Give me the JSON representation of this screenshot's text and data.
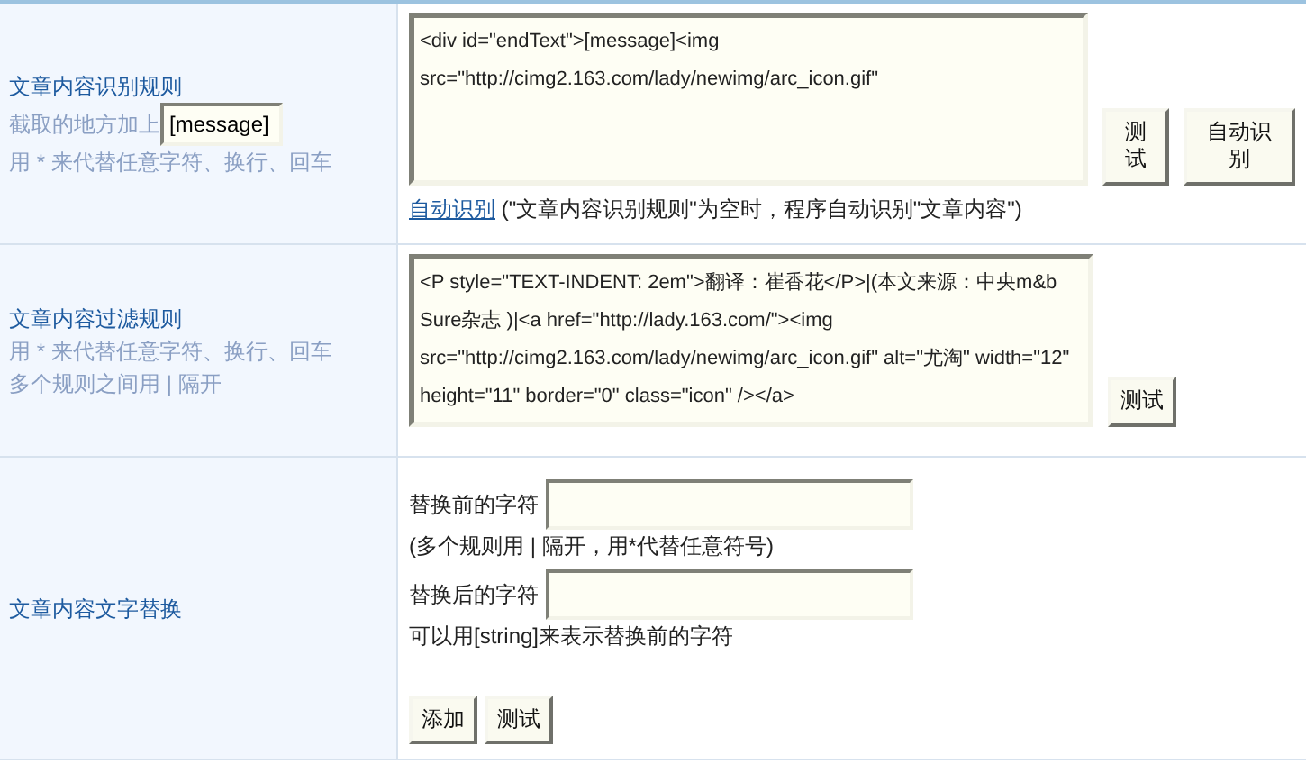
{
  "rows": [
    {
      "kind": "rule",
      "label": "文章内容识别规则",
      "inline_hint": {
        "text": "截取的地方加上",
        "value": "[message]"
      },
      "hints": [
        "用 * 来代替任意字符、换行、回车"
      ],
      "textarea": "<div id=\"endText\">[message]<img src=\"http://cimg2.163.com/lady/newimg/arc_icon.gif\"",
      "buttons": [
        "测试",
        "自动识别"
      ],
      "note": {
        "link": "自动识别",
        "text": "(\"文章内容识别规则\"为空时，程序自动识别\"文章内容\")"
      }
    },
    {
      "kind": "rule",
      "label": "文章内容过滤规则",
      "hints": [
        "用 * 来代替任意字符、换行、回车",
        "多个规则之间用 | 隔开"
      ],
      "textarea": "<P style=\"TEXT-INDENT: 2em\">翻译：崔香花</P>|(本文来源：中央m&b Sure杂志 )|<a href=\"http://lady.163.com/\"><img src=\"http://cimg2.163.com/lady/newimg/arc_icon.gif\" alt=\"尤淘\" width=\"12\" height=\"11\" border=\"0\" class=\"icon\" /></a>",
      "buttons": [
        "测试"
      ]
    },
    {
      "kind": "replace",
      "label": "文章内容文字替换",
      "fields": [
        {
          "label": "替换前的字符",
          "note": "(多个规则用 | 隔开，用*代替任意符号)"
        },
        {
          "label": "替换后的字符",
          "note": "可以用[string]来表示替换前的字符"
        }
      ],
      "buttons": [
        "添加",
        "测试"
      ]
    }
  ]
}
